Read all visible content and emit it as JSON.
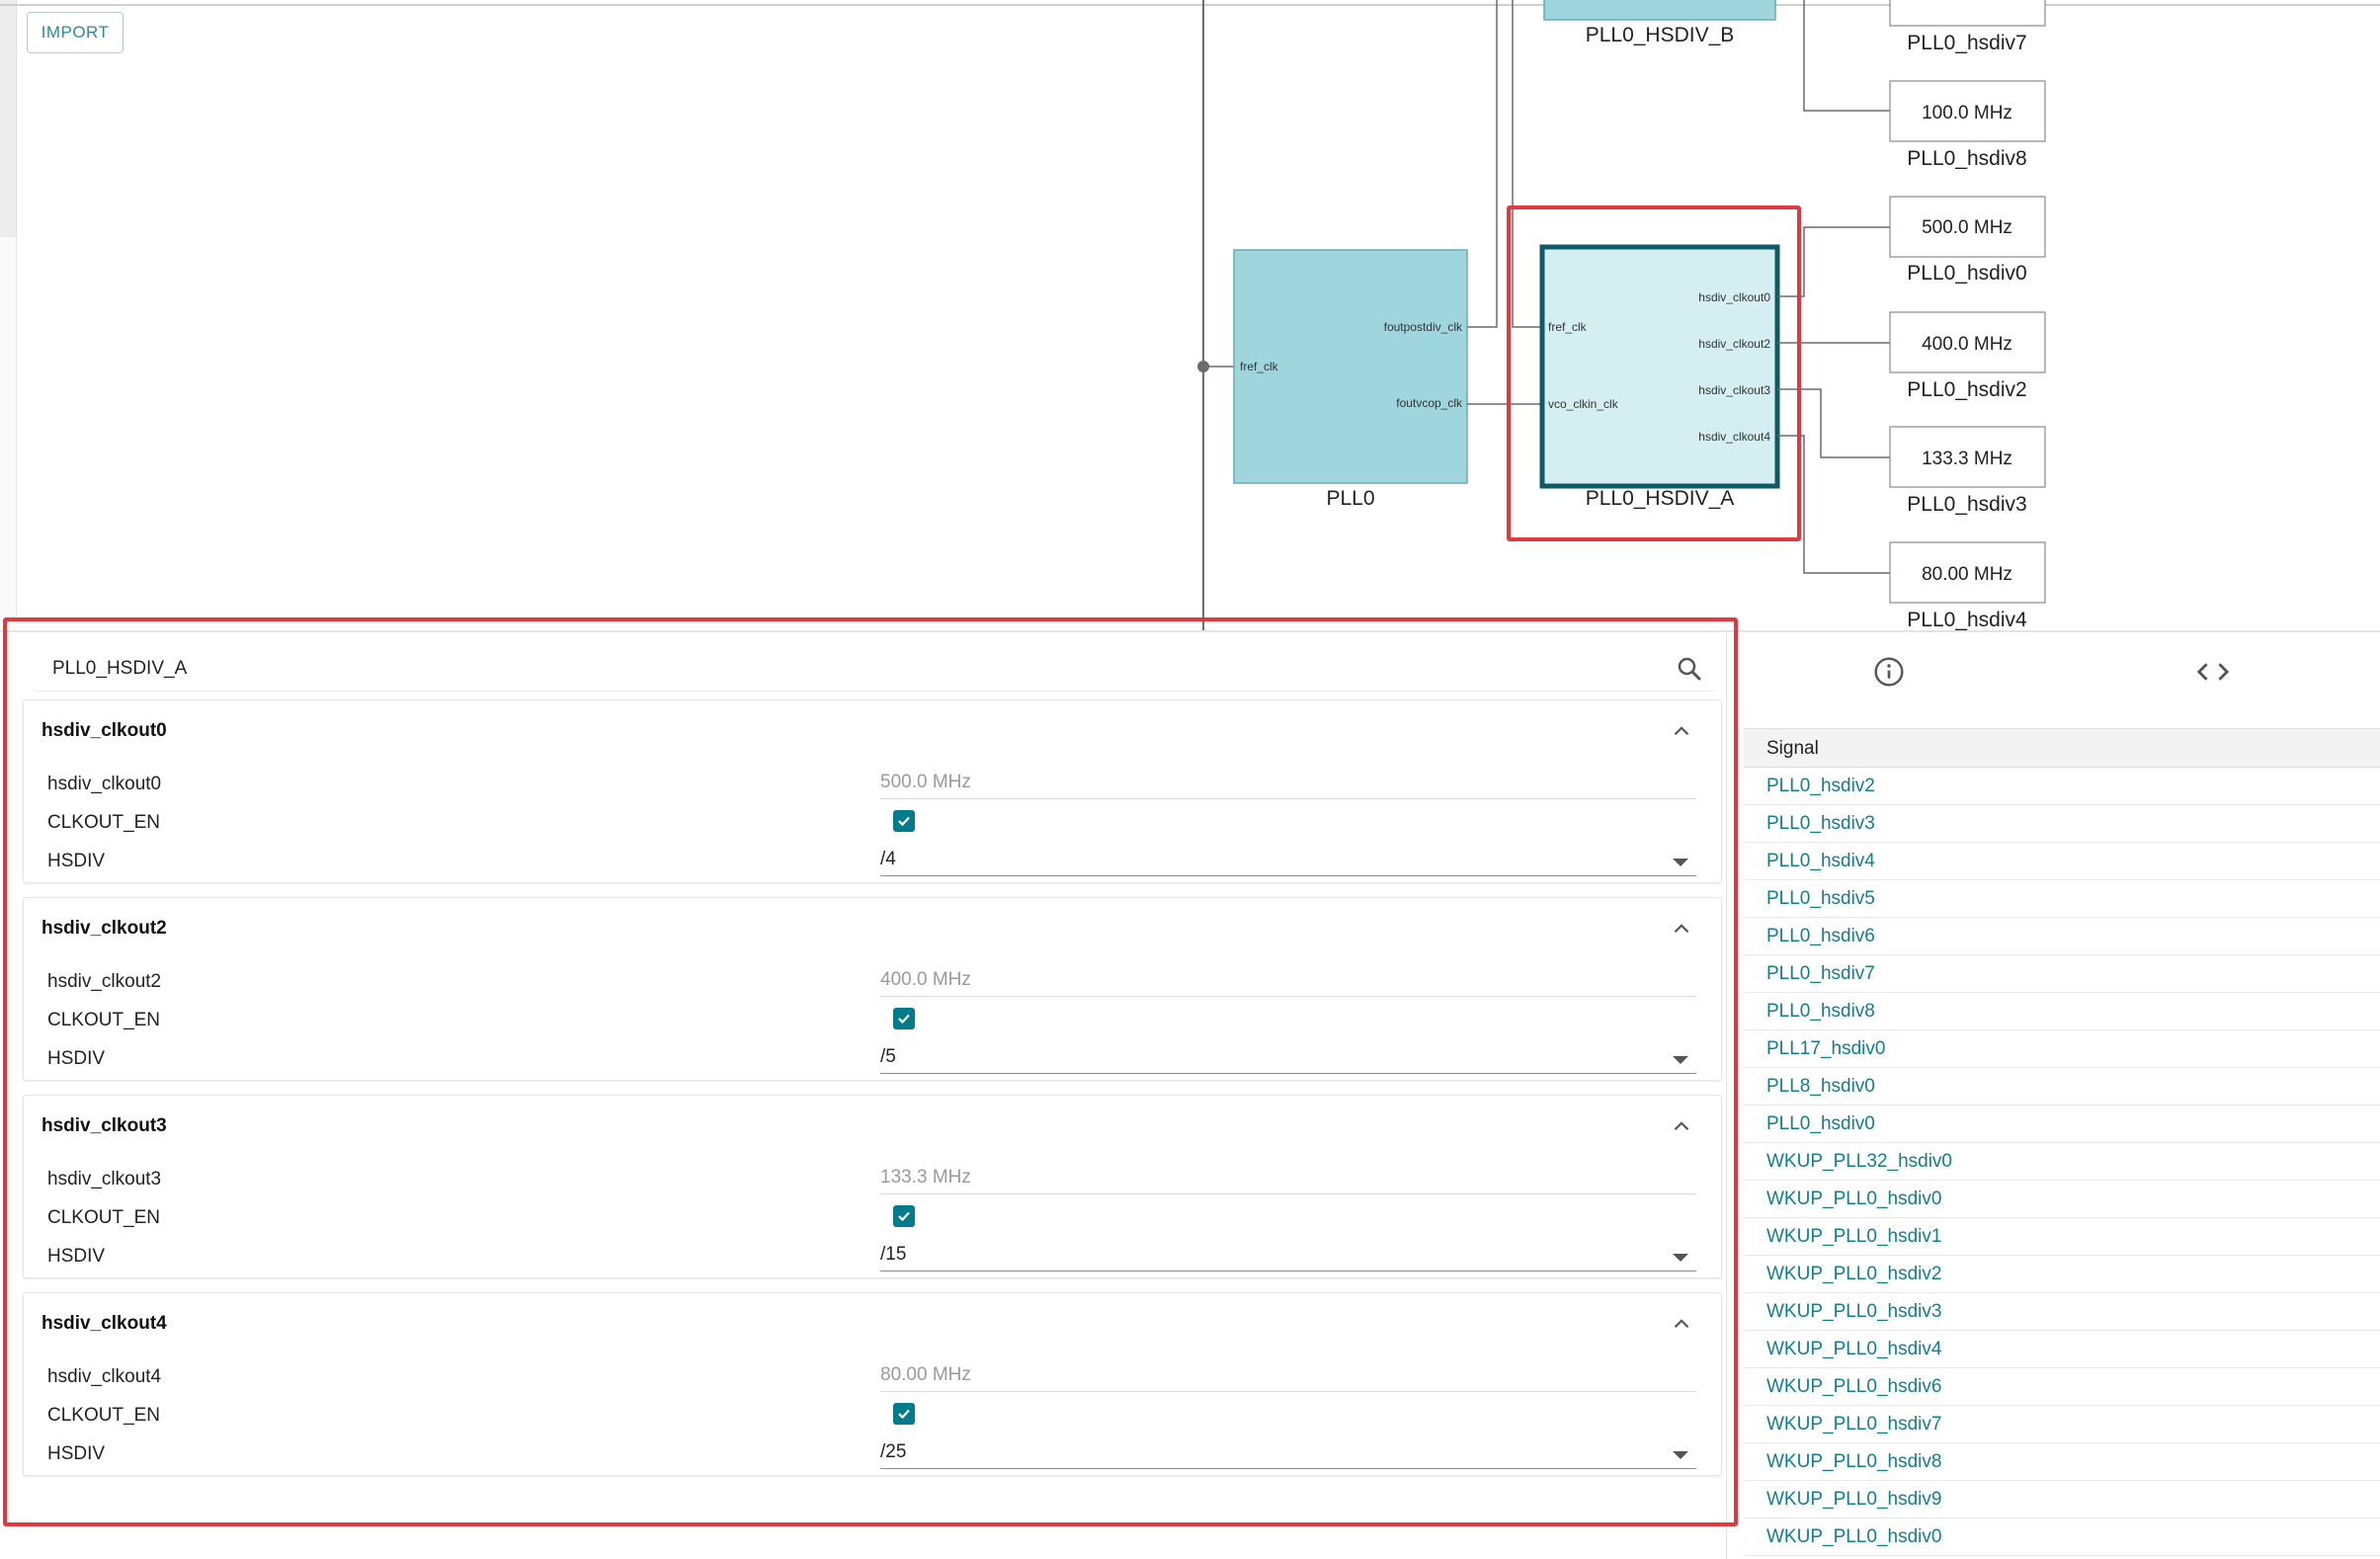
{
  "toolbar": {
    "import_label": "IMPORT"
  },
  "diagram": {
    "pll_block": {
      "name": "PLL0",
      "in_port": "fref_clk",
      "out_port_1": "foutpostdiv_clk",
      "out_port_2": "foutvcop_clk"
    },
    "hsdiv_a_block": {
      "name": "PLL0_HSDIV_A",
      "in_port_1": "fref_clk",
      "in_port_2": "vco_clkin_clk",
      "outputs": [
        "hsdiv_clkout0",
        "hsdiv_clkout2",
        "hsdiv_clkout3",
        "hsdiv_clkout4"
      ]
    },
    "hsdiv_b_block": {
      "name": "PLL0_HSDIV_B"
    },
    "outputs": [
      {
        "freq": "",
        "name": "PLL0_hsdiv7"
      },
      {
        "freq": "100.0 MHz",
        "name": "PLL0_hsdiv8"
      },
      {
        "freq": "500.0 MHz",
        "name": "PLL0_hsdiv0"
      },
      {
        "freq": "400.0 MHz",
        "name": "PLL0_hsdiv2"
      },
      {
        "freq": "133.3 MHz",
        "name": "PLL0_hsdiv3"
      },
      {
        "freq": "80.00 MHz",
        "name": "PLL0_hsdiv4"
      }
    ]
  },
  "properties": {
    "search_title": "PLL0_HSDIV_A",
    "sections": [
      {
        "title": "hsdiv_clkout0",
        "freq_label": "hsdiv_clkout0",
        "freq_value": "500.0 MHz",
        "en_label": "CLKOUT_EN",
        "div_label": "HSDIV",
        "div_value": "/4"
      },
      {
        "title": "hsdiv_clkout2",
        "freq_label": "hsdiv_clkout2",
        "freq_value": "400.0 MHz",
        "en_label": "CLKOUT_EN",
        "div_label": "HSDIV",
        "div_value": "/5"
      },
      {
        "title": "hsdiv_clkout3",
        "freq_label": "hsdiv_clkout3",
        "freq_value": "133.3 MHz",
        "en_label": "CLKOUT_EN",
        "div_label": "HSDIV",
        "div_value": "/15"
      },
      {
        "title": "hsdiv_clkout4",
        "freq_label": "hsdiv_clkout4",
        "freq_value": "80.00 MHz",
        "en_label": "CLKOUT_EN",
        "div_label": "HSDIV",
        "div_value": "/25"
      }
    ]
  },
  "signals": {
    "header": "Signal",
    "items": [
      "PLL0_hsdiv2",
      "PLL0_hsdiv3",
      "PLL0_hsdiv4",
      "PLL0_hsdiv5",
      "PLL0_hsdiv6",
      "PLL0_hsdiv7",
      "PLL0_hsdiv8",
      "PLL17_hsdiv0",
      "PLL8_hsdiv0",
      "PLL0_hsdiv0",
      "WKUP_PLL32_hsdiv0",
      "WKUP_PLL0_hsdiv0",
      "WKUP_PLL0_hsdiv1",
      "WKUP_PLL0_hsdiv2",
      "WKUP_PLL0_hsdiv3",
      "WKUP_PLL0_hsdiv4",
      "WKUP_PLL0_hsdiv6",
      "WKUP_PLL0_hsdiv7",
      "WKUP_PLL0_hsdiv8",
      "WKUP_PLL0_hsdiv9",
      "WKUP_PLL0_hsdiv0"
    ]
  },
  "colors": {
    "accent": "#0f7f90",
    "pll_fill": "#9fd6de",
    "hsdiv_fill": "#d4eef1",
    "hsdiv_border": "#0e5a66",
    "highlight": "#e03a3e"
  }
}
